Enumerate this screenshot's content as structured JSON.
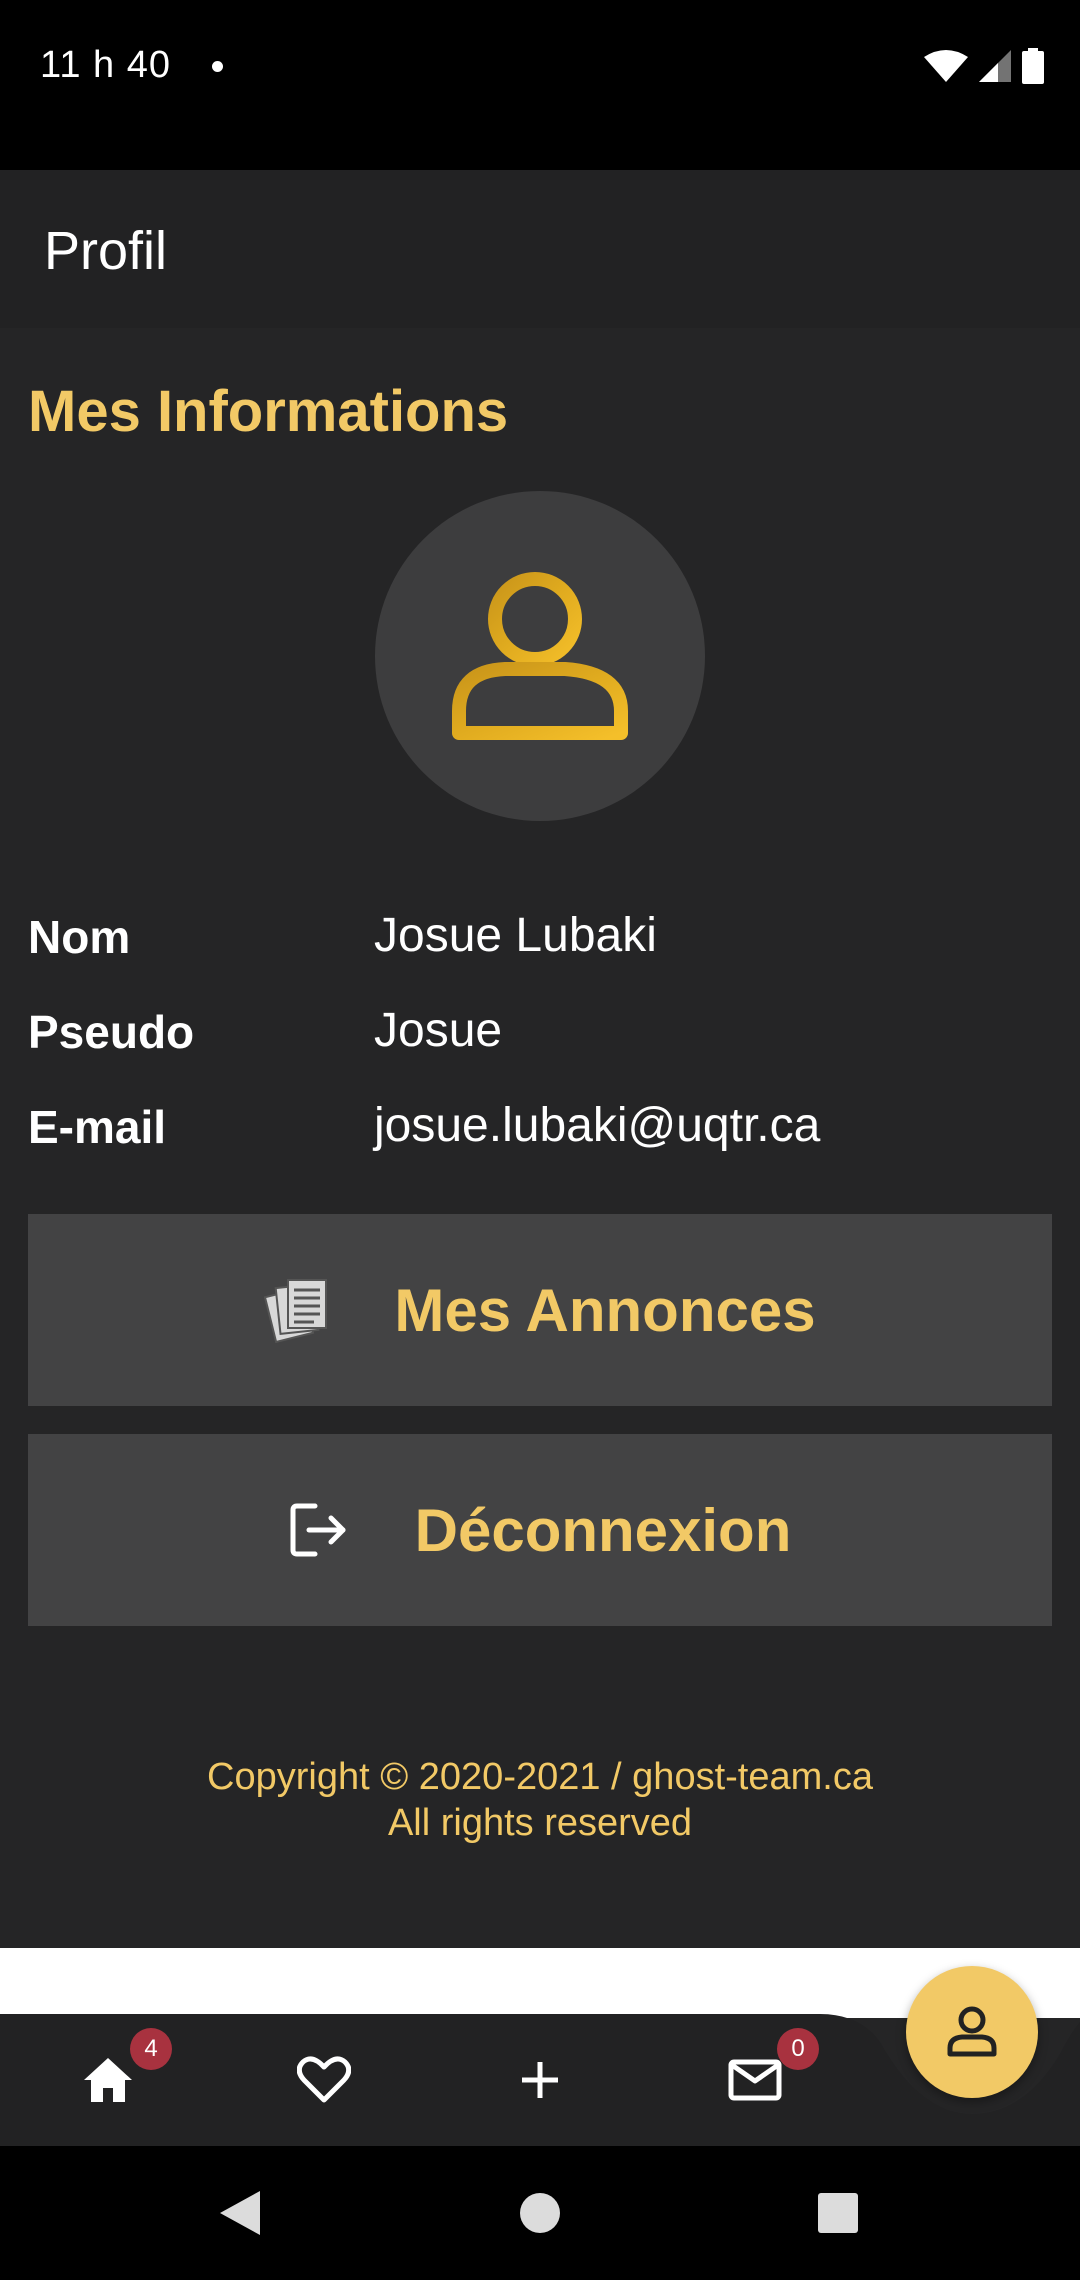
{
  "status_bar": {
    "time": "11 h 40"
  },
  "app_bar": {
    "title": "Profil"
  },
  "section": {
    "title": "Mes Informations"
  },
  "profile": {
    "fields": [
      {
        "label": "Nom",
        "value": "Josue Lubaki"
      },
      {
        "label": "Pseudo",
        "value": "Josue"
      },
      {
        "label": "E-mail",
        "value": "josue.lubaki@uqtr.ca"
      }
    ]
  },
  "actions": {
    "my_ads": {
      "label": "Mes Annonces",
      "icon": "documents-icon"
    },
    "logout": {
      "label": "Déconnexion",
      "icon": "logout-icon"
    }
  },
  "footer": {
    "line1": "Copyright © 2020-2021 / ghost-team.ca",
    "line2": "All rights reserved"
  },
  "bottom_nav": {
    "home": {
      "icon": "home-icon",
      "badge": "4"
    },
    "favorites": {
      "icon": "heart-icon"
    },
    "add": {
      "icon": "plus-icon"
    },
    "messages": {
      "icon": "mail-icon",
      "badge": "0"
    },
    "profile": {
      "icon": "person-icon",
      "active": true
    }
  },
  "colors": {
    "accent": "#f2c966",
    "background": "#252526",
    "app_bar": "#222223",
    "button": "#434344",
    "badge": "#a8323f"
  }
}
